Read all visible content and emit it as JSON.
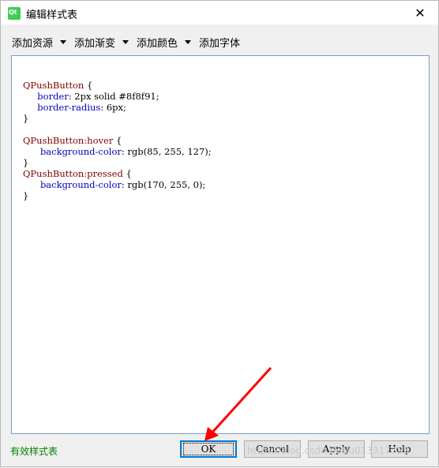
{
  "window": {
    "title": "编辑样式表",
    "app_icon": "qt-designer-icon",
    "close_label": "✕"
  },
  "toolbar": {
    "items": [
      {
        "label": "添加资源"
      },
      {
        "label": "添加渐变"
      },
      {
        "label": "添加颜色"
      },
      {
        "label": "添加字体"
      }
    ]
  },
  "editor": {
    "lines": [
      {
        "sel": "QPushButton",
        "rest": " {"
      },
      {
        "indent": "     ",
        "prop": "border",
        "rest": ": 2px solid #8f8f91;"
      },
      {
        "indent": "     ",
        "prop": "border-radius",
        "rest": ": 6px;"
      },
      {
        "rest": "}"
      },
      {
        "rest": ""
      },
      {
        "sel": "QPushButton:hover",
        "rest": " {"
      },
      {
        "indent": "      ",
        "prop": "background-color",
        "rest": ": rgb(85, 255, 127);"
      },
      {
        "rest": "}"
      },
      {
        "sel": "QPushButton:pressed",
        "rest": " {"
      },
      {
        "indent": "      ",
        "prop": "background-color",
        "rest": ": rgb(170, 255, 0);"
      },
      {
        "rest": "}"
      }
    ]
  },
  "status": {
    "text": "有效样式表",
    "color": "#008000"
  },
  "buttons": {
    "ok": "OK",
    "cancel": "Cancel",
    "apply": "Apply",
    "help": "Help"
  },
  "watermark": "https://blog.csdn.net/u013317753",
  "annotation": {
    "type": "red-arrow",
    "color": "#ff0000",
    "target": "OK"
  }
}
